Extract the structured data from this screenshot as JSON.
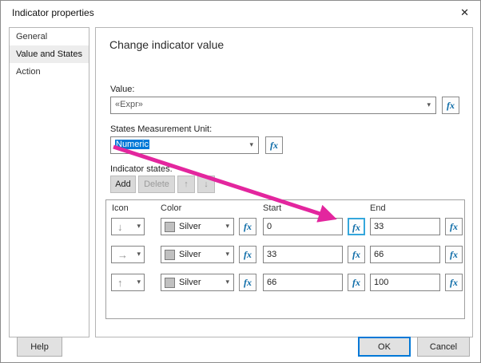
{
  "window": {
    "title": "Indicator properties",
    "close_label": "✕"
  },
  "sidebar": {
    "items": [
      {
        "label": "General"
      },
      {
        "label": "Value and States"
      },
      {
        "label": "Action"
      }
    ]
  },
  "main": {
    "heading": "Change indicator value",
    "value": {
      "label": "Value:",
      "text": "«Expr»"
    },
    "unit": {
      "label": "States Measurement Unit:",
      "value": "Numeric"
    },
    "states": {
      "label": "Indicator states:",
      "add_label": "Add",
      "delete_label": "Delete"
    },
    "table": {
      "headers": {
        "icon": "Icon",
        "color": "Color",
        "start": "Start",
        "end": "End"
      },
      "rows": [
        {
          "icon_glyph": "↓",
          "color": "Silver",
          "start": "0",
          "end": "33"
        },
        {
          "icon_glyph": "→",
          "color": "Silver",
          "start": "33",
          "end": "66"
        },
        {
          "icon_glyph": "↑",
          "color": "Silver",
          "start": "66",
          "end": "100"
        }
      ]
    }
  },
  "footer": {
    "help": "Help",
    "ok": "OK",
    "cancel": "Cancel"
  },
  "icons": {
    "fx": "fx",
    "dropdown": "▾",
    "move_up": "↑",
    "move_down": "↓"
  },
  "colors": {
    "accent": "#0078d7",
    "annotation_arrow": "#e3269e",
    "silver": "#c0c0c0",
    "fx_blue": "#0d6ca8"
  }
}
